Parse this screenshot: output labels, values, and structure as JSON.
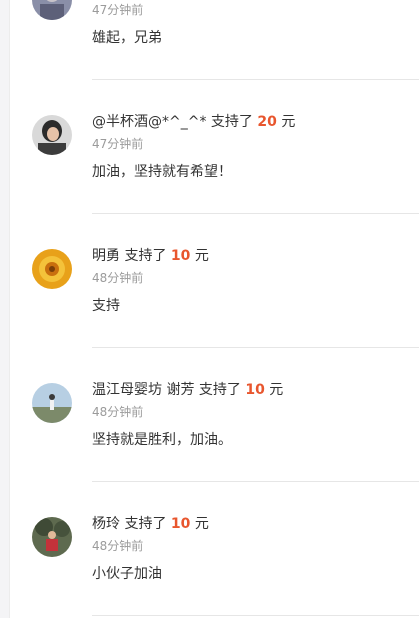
{
  "comments": [
    {
      "name": "",
      "action": "",
      "amount": "",
      "unit": "",
      "time": "47分钟前",
      "message": "雄起，兄弟",
      "avatar_icon": "avatar-photo-icon"
    },
    {
      "name": "@半杯酒@*^_^*",
      "action": "支持了",
      "amount": "20",
      "unit": "元",
      "time": "47分钟前",
      "message": "加油，坚持就有希望！",
      "avatar_icon": "avatar-photo-icon"
    },
    {
      "name": "明勇",
      "action": "支持了",
      "amount": "10",
      "unit": "元",
      "time": "48分钟前",
      "message": "支持",
      "avatar_icon": "avatar-photo-icon"
    },
    {
      "name": "温江母婴坊 谢芳",
      "action": "支持了",
      "amount": "10",
      "unit": "元",
      "time": "48分钟前",
      "message": "坚持就是胜利，加油。",
      "avatar_icon": "avatar-photo-icon"
    },
    {
      "name": "杨玲",
      "action": "支持了",
      "amount": "10",
      "unit": "元",
      "time": "48分钟前",
      "message": "小伙子加油",
      "avatar_icon": "avatar-photo-icon"
    }
  ],
  "colors": {
    "amount": "#e8562e",
    "text": "#333333",
    "muted": "#9b9b9b",
    "divider": "#e6e6e6"
  }
}
